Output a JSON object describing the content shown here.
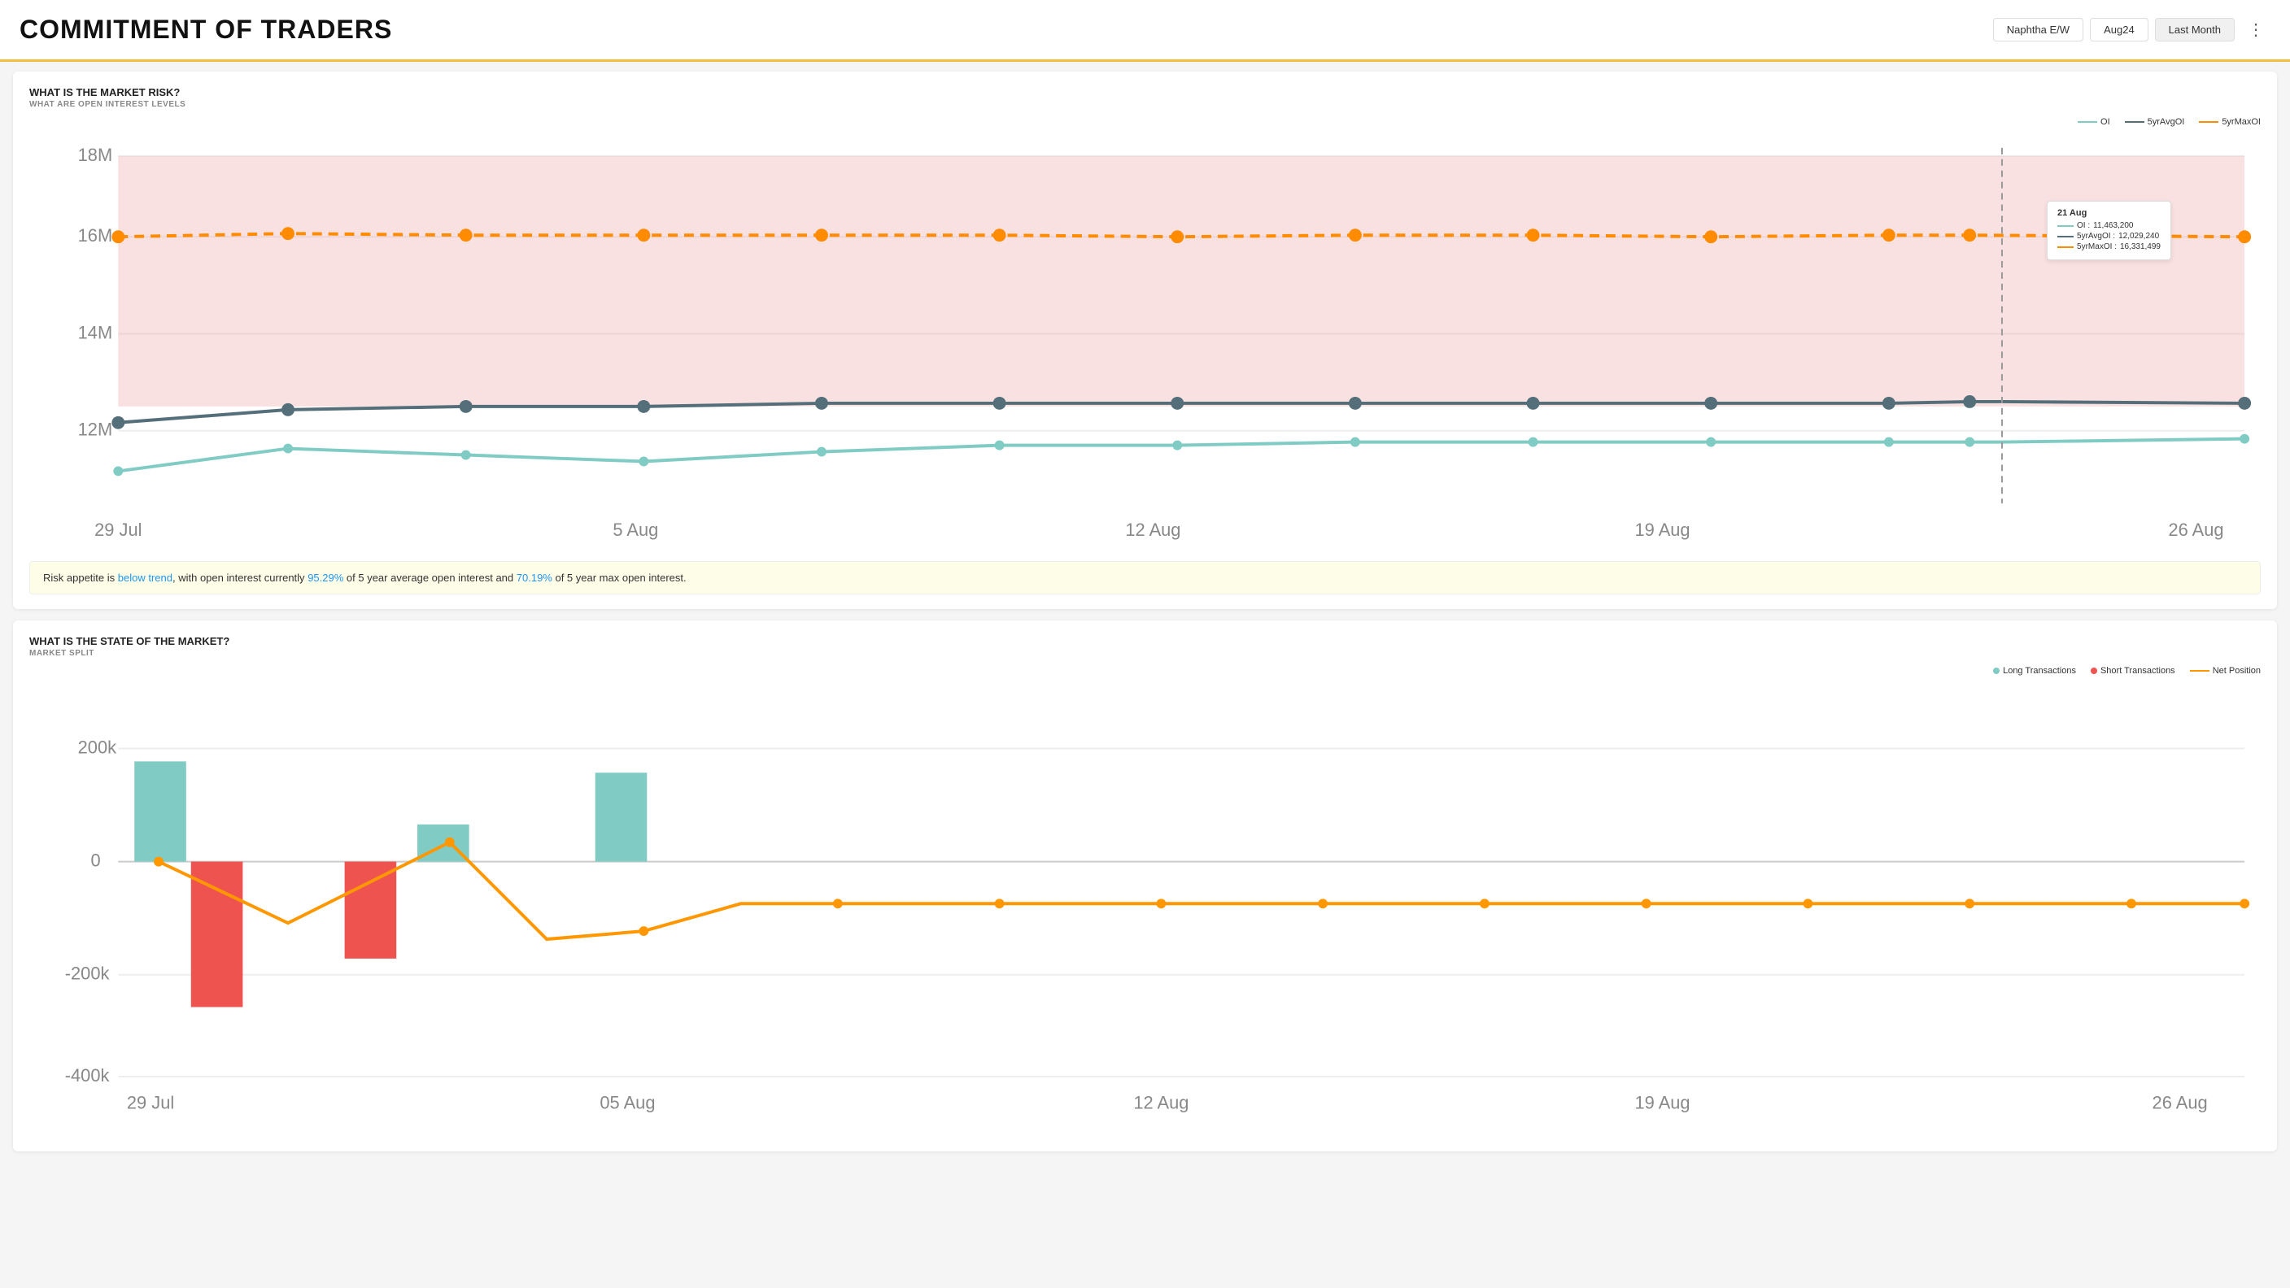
{
  "header": {
    "title": "COMMITMENT OF TRADERS",
    "controls": {
      "commodity_label": "Naphtha E/W",
      "period_label": "Aug24",
      "range_label": "Last Month",
      "more_icon": "⋮"
    }
  },
  "card1": {
    "title": "WHAT IS THE MARKET RISK?",
    "subtitle": "WHAT ARE OPEN INTEREST LEVELS",
    "legend": {
      "oi_label": "OI",
      "avg_label": "5yrAvgOI",
      "max_label": "5yrMaxOI"
    },
    "y_axis": [
      "18M",
      "16M",
      "14M",
      "12M"
    ],
    "x_axis": [
      "29 Jul",
      "5 Aug",
      "12 Aug",
      "19 Aug",
      "26 Aug"
    ],
    "tooltip": {
      "date": "21 Aug",
      "oi_label": "OI :",
      "oi_value": "11,463,200",
      "avg_label": "5yrAvgOI :",
      "avg_value": "12,029,240",
      "max_label": "5yrMaxOI :",
      "max_value": "16,331,499"
    },
    "risk_text_prefix": "Risk appetite is ",
    "risk_link": "below trend",
    "risk_text_mid": ", with open interest currently ",
    "risk_pct1": "95.29%",
    "risk_text_mid2": " of 5 year average open interest and ",
    "risk_pct2": "70.19%",
    "risk_text_end": " of 5 year max open interest."
  },
  "card2": {
    "title": "WHAT IS THE STATE OF THE MARKET?",
    "subtitle": "MARKET SPLIT",
    "legend": {
      "long_label": "Long Transactions",
      "short_label": "Short Transactions",
      "net_label": "Net Position"
    },
    "y_axis": [
      "200k",
      "0",
      "-200k",
      "-400k"
    ],
    "x_axis": [
      "29 Jul",
      "05 Aug",
      "12 Aug",
      "19 Aug",
      "26 Aug"
    ]
  },
  "colors": {
    "oi": "#80cbc4",
    "avg": "#546e7a",
    "max": "#ff8c00",
    "long": "#80cbc4",
    "short": "#ef5350",
    "net": "#ff9800",
    "band": "rgba(239,154,154,0.35)",
    "yellow_bar": "#f0c040"
  }
}
